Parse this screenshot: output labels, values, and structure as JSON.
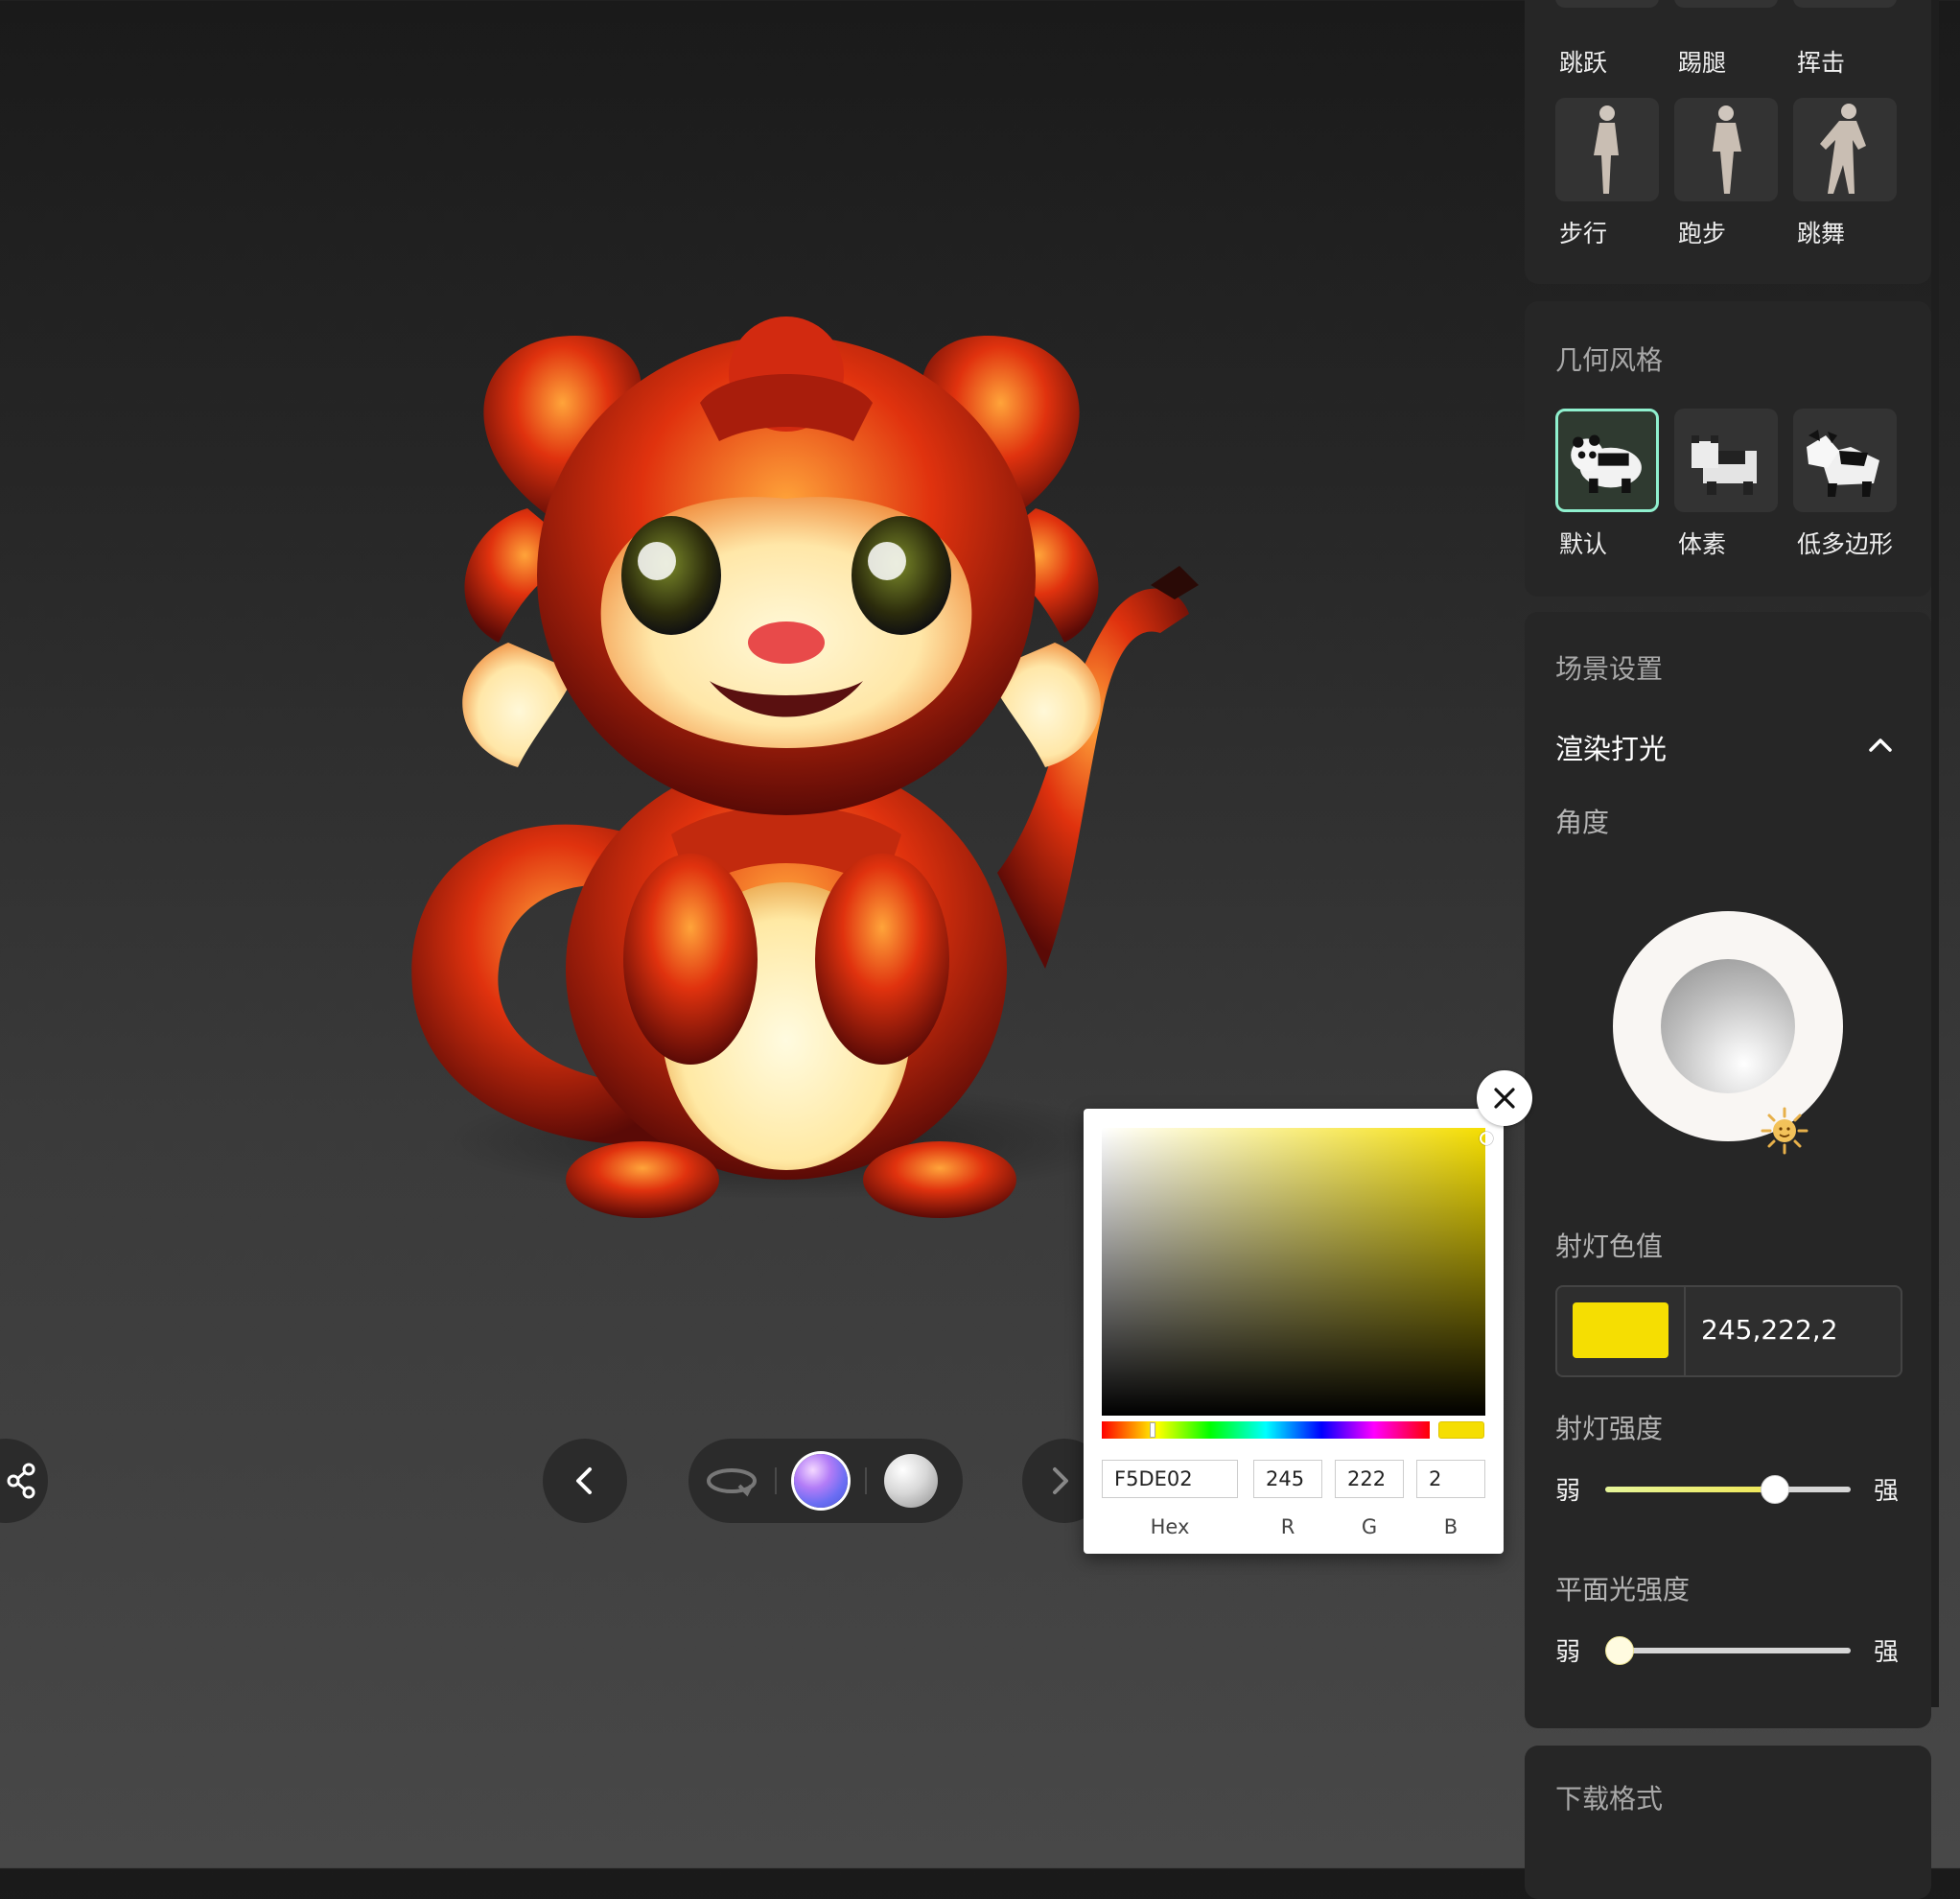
{
  "motion_presets": {
    "row1": [
      {
        "label": "跳跃"
      },
      {
        "label": "踢腿"
      },
      {
        "label": "挥击"
      }
    ],
    "row2": [
      {
        "label": "步行"
      },
      {
        "label": "跑步"
      },
      {
        "label": "跳舞"
      }
    ]
  },
  "geometry_style": {
    "title": "几何风格",
    "options": [
      {
        "label": "默认",
        "selected": true
      },
      {
        "label": "体素",
        "selected": false
      },
      {
        "label": "低多边形",
        "selected": false
      }
    ]
  },
  "scene_settings": {
    "title": "场景设置",
    "lighting": {
      "header": "渲染打光",
      "expanded": true,
      "angle_label": "角度",
      "spotlight_color_label": "射灯色值",
      "spotlight_color_value": "245,222,2",
      "spotlight_color_hex": "#F5DE02",
      "spotlight_intensity": {
        "label": "射灯强度",
        "weak": "弱",
        "strong": "强",
        "value_fraction": 0.69
      },
      "plane_light_intensity": {
        "label": "平面光强度",
        "weak": "弱",
        "strong": "强",
        "value_fraction": 0.0
      }
    }
  },
  "download": {
    "title": "下载格式"
  },
  "color_picker": {
    "hex": "F5DE02",
    "r": "245",
    "g": "222",
    "b": "2",
    "labels": {
      "hex": "Hex",
      "r": "R",
      "g": "G",
      "b": "B"
    },
    "color": "#f5de02"
  },
  "viewer_toolbar": {
    "material_options": [
      "rotate-icon",
      "gradient-material",
      "white-material"
    ],
    "selected_material": "gradient-material"
  }
}
